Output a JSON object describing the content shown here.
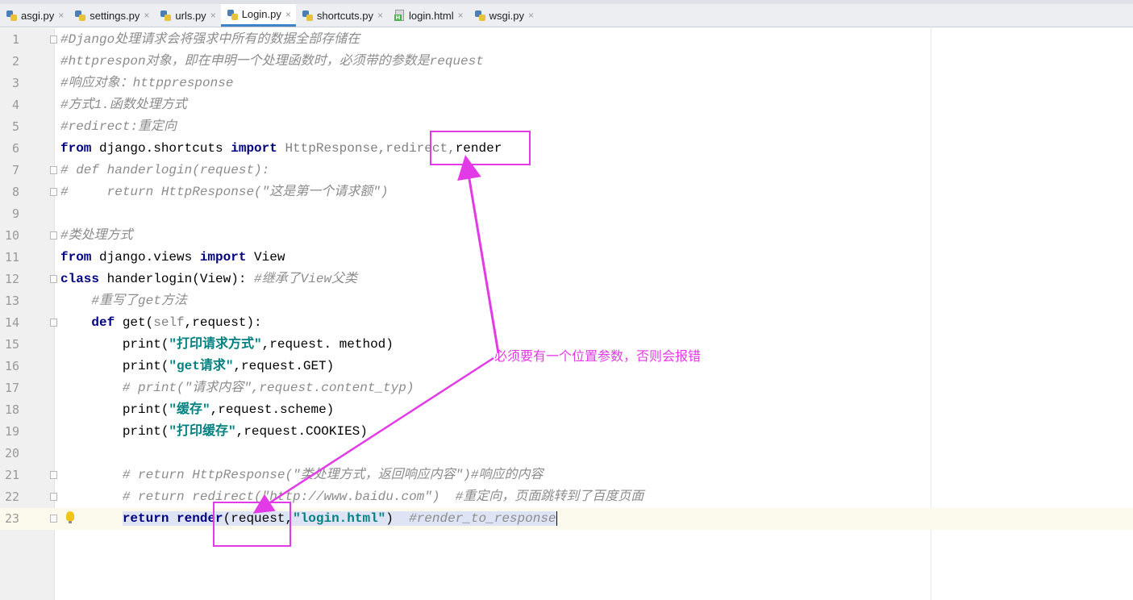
{
  "tabs": [
    {
      "name": "asgi.py",
      "type": "py",
      "active": false
    },
    {
      "name": "settings.py",
      "type": "py",
      "active": false
    },
    {
      "name": "urls.py",
      "type": "py",
      "active": false
    },
    {
      "name": "Login.py",
      "type": "py",
      "active": true
    },
    {
      "name": "shortcuts.py",
      "type": "py",
      "active": false
    },
    {
      "name": "login.html",
      "type": "html",
      "active": false
    },
    {
      "name": "wsgi.py",
      "type": "py",
      "active": false
    }
  ],
  "tab_close_glyph": "×",
  "lines": [
    {
      "n": "1",
      "fold": true,
      "tokens": [
        {
          "c": "cm",
          "t": "#Django处理请求会将强求中所有的数据全部存储在"
        }
      ]
    },
    {
      "n": "2",
      "tokens": [
        {
          "c": "cm",
          "t": "#httprespon对象，即在申明一个处理函数时，必须带的参数是request"
        }
      ]
    },
    {
      "n": "3",
      "tokens": [
        {
          "c": "cm",
          "t": "#响应对象：httppresponse"
        }
      ]
    },
    {
      "n": "4",
      "tokens": [
        {
          "c": "cm",
          "t": "#方式1.函数处理方式"
        }
      ]
    },
    {
      "n": "5",
      "tokens": [
        {
          "c": "cm",
          "t": "#redirect:重定向"
        }
      ]
    },
    {
      "n": "6",
      "tokens": [
        {
          "c": "kw",
          "t": "from"
        },
        {
          "c": "",
          "t": " django.shortcuts "
        },
        {
          "c": "kw",
          "t": "import"
        },
        {
          "c": "gray",
          "t": " HttpResponse,redirect,"
        },
        {
          "c": "",
          "t": "render"
        }
      ]
    },
    {
      "n": "7",
      "fold": true,
      "tokens": [
        {
          "c": "cm",
          "t": "# def handerlogin(request):"
        }
      ]
    },
    {
      "n": "8",
      "fold": true,
      "tokens": [
        {
          "c": "cm",
          "t": "#     return HttpResponse(\"这是第一个请求额\")"
        }
      ]
    },
    {
      "n": "9",
      "tokens": []
    },
    {
      "n": "10",
      "fold": true,
      "tokens": [
        {
          "c": "cm",
          "t": "#类处理方式"
        }
      ]
    },
    {
      "n": "11",
      "tokens": [
        {
          "c": "kw",
          "t": "from"
        },
        {
          "c": "",
          "t": " django.views "
        },
        {
          "c": "kw",
          "t": "import"
        },
        {
          "c": "",
          "t": " View"
        }
      ]
    },
    {
      "n": "12",
      "fold": true,
      "tokens": [
        {
          "c": "kw",
          "t": "class"
        },
        {
          "c": "",
          "t": " handerlogin(View): "
        },
        {
          "c": "cm",
          "t": "#继承了View父类"
        }
      ]
    },
    {
      "n": "13",
      "tokens": [
        {
          "c": "cm",
          "t": "    #重写了get方法"
        }
      ]
    },
    {
      "n": "14",
      "fold": true,
      "tokens": [
        {
          "c": "",
          "t": "    "
        },
        {
          "c": "kw",
          "t": "def"
        },
        {
          "c": "",
          "t": " get("
        },
        {
          "c": "gray",
          "t": "self"
        },
        {
          "c": "",
          "t": ",request):"
        }
      ]
    },
    {
      "n": "15",
      "tokens": [
        {
          "c": "",
          "t": "        print("
        },
        {
          "c": "str",
          "t": "\"打印请求方式\""
        },
        {
          "c": "",
          "t": ",request. method)"
        }
      ]
    },
    {
      "n": "16",
      "tokens": [
        {
          "c": "",
          "t": "        print("
        },
        {
          "c": "str",
          "t": "\"get请求\""
        },
        {
          "c": "",
          "t": ",request.GET)"
        }
      ]
    },
    {
      "n": "17",
      "tokens": [
        {
          "c": "cm",
          "t": "        # print(\"请求内容\",request.content_typ)"
        }
      ]
    },
    {
      "n": "18",
      "tokens": [
        {
          "c": "",
          "t": "        print("
        },
        {
          "c": "str",
          "t": "\"缓存\""
        },
        {
          "c": "",
          "t": ",request.scheme)"
        }
      ]
    },
    {
      "n": "19",
      "tokens": [
        {
          "c": "",
          "t": "        print("
        },
        {
          "c": "str",
          "t": "\"打印缓存\""
        },
        {
          "c": "",
          "t": ",request.COOKIES)"
        }
      ]
    },
    {
      "n": "20",
      "tokens": []
    },
    {
      "n": "21",
      "fold": true,
      "tokens": [
        {
          "c": "cm",
          "t": "        # return HttpResponse(\"类处理方式，返回响应内容\")#响应的内容"
        }
      ]
    },
    {
      "n": "22",
      "fold": true,
      "tokens": [
        {
          "c": "cm",
          "t": "        # return redirect(\"http://www.baidu.com\")  #重定向，页面跳转到了百度页面"
        }
      ]
    },
    {
      "n": "23",
      "fold": true,
      "bulb": true,
      "current": true,
      "tokens": [
        {
          "c": "",
          "t": "        "
        },
        {
          "c": "kw sel",
          "t": "return"
        },
        {
          "c": "sel",
          "t": " "
        },
        {
          "c": "kw sel",
          "t": "render"
        },
        {
          "c": "sel",
          "t": "(request,"
        },
        {
          "c": "str sel",
          "t": "\"login.html\""
        },
        {
          "c": "sel",
          "t": ")  "
        },
        {
          "c": "cm sel",
          "t": "#render_to_response"
        }
      ]
    }
  ],
  "annotation": {
    "text": "必须要有一个位置参数，否则会报错",
    "color": "#e23ae6"
  },
  "colors": {
    "keyword": "#000080",
    "string": "#008080",
    "comment": "#8c8c8c",
    "annotation": "#e23ae6",
    "current_line": "#fcfaed",
    "active_tab_underline": "#4083c9"
  }
}
